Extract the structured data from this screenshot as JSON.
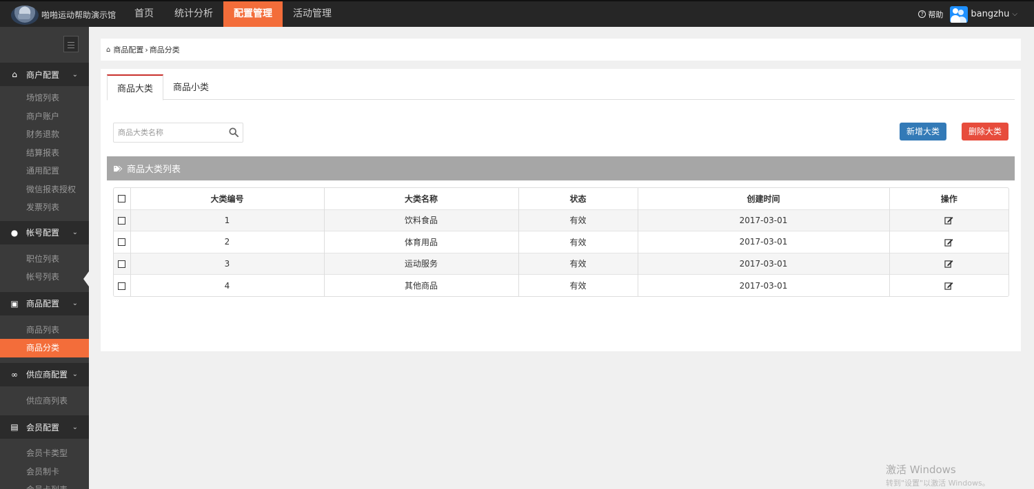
{
  "topbar": {
    "brand": "啪啪运动帮助演示馆",
    "nav": [
      "首页",
      "统计分析",
      "配置管理",
      "活动管理"
    ],
    "active_nav": "配置管理",
    "help": "帮助",
    "username": "bangzhu"
  },
  "sidebar": {
    "groups": [
      {
        "title": "商户配置",
        "icon": "home-icon",
        "items": [
          "场馆列表",
          "商户账户",
          "财务退款",
          "结算报表",
          "通用配置",
          "微信报表授权",
          "发票列表"
        ]
      },
      {
        "title": "帐号配置",
        "icon": "user-icon",
        "items": [
          "职位列表",
          "帐号列表"
        ]
      },
      {
        "title": "商品配置",
        "icon": "gift-icon",
        "items": [
          "商品列表",
          "商品分类"
        ]
      },
      {
        "title": "供应商配置",
        "icon": "link-icon",
        "items": [
          "供应商列表"
        ]
      },
      {
        "title": "会员配置",
        "icon": "id-card-icon",
        "items": [
          "会员卡类型",
          "会员制卡",
          "会员卡列表"
        ]
      }
    ],
    "active_item": "商品分类"
  },
  "breadcrumb": {
    "parent": "商品配置",
    "current": "商品分类"
  },
  "tabs": [
    "商品大类",
    "商品小类"
  ],
  "active_tab": "商品大类",
  "search": {
    "placeholder": "商品大类名称"
  },
  "buttons": {
    "add": "新增大类",
    "delete": "删除大类"
  },
  "list_title": "商品大类列表",
  "table": {
    "headers": [
      "大类编号",
      "大类名称",
      "状态",
      "创建时间",
      "操作"
    ],
    "rows": [
      {
        "id": "1",
        "name": "饮料食品",
        "status": "有效",
        "created": "2017-03-01"
      },
      {
        "id": "2",
        "name": "体育用品",
        "status": "有效",
        "created": "2017-03-01"
      },
      {
        "id": "3",
        "name": "运动服务",
        "status": "有效",
        "created": "2017-03-01"
      },
      {
        "id": "4",
        "name": "其他商品",
        "status": "有效",
        "created": "2017-03-01"
      }
    ]
  },
  "watermark": {
    "line1": "激活 Windows",
    "line2": "转到\"设置\"以激活 Windows。"
  },
  "colors": {
    "accent": "#f36d3a",
    "primary": "#337ab7",
    "danger": "#e74c3c",
    "sidebar": "#3a3a3a",
    "topbar": "#262626"
  }
}
